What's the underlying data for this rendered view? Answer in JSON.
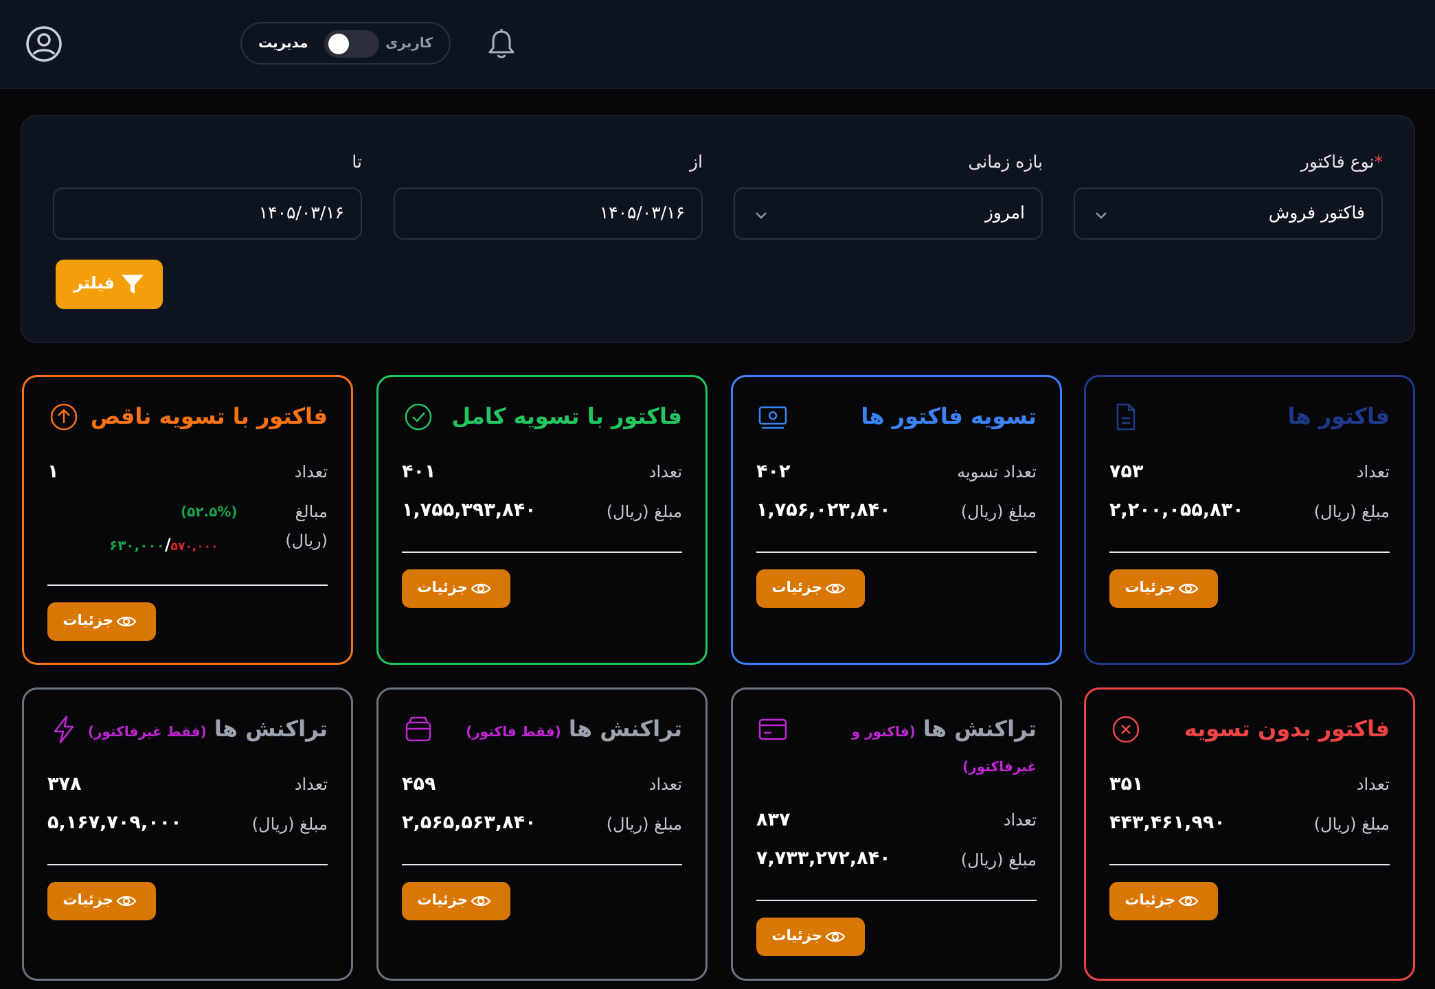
{
  "header": {
    "mode_admin": "مدیریت",
    "mode_user": "کاربری"
  },
  "filter": {
    "invoice_type_label": "نوع فاکتور",
    "invoice_type_required": "*",
    "invoice_type_value": "فاکتور فروش",
    "range_label": "بازه زمانی",
    "range_value": "امروز",
    "from_label": "از",
    "from_value": "۱۴۰۵/۰۳/۱۶",
    "to_label": "تا",
    "to_value": "۱۴۰۵/۰۳/۱۶",
    "button_label": "فیلتر"
  },
  "cards": {
    "invoices": {
      "title": "فاکتور ها",
      "count_label": "تعداد",
      "count": "۷۵۳",
      "amount_label": "مبلغ (ریال)",
      "amount": "۲,۲۰۰,۰۵۵,۸۳۰",
      "details": "جزئیات"
    },
    "settlements": {
      "title": "تسویه فاکتور ها",
      "count_label": "تعداد تسویه",
      "count": "۴۰۲",
      "amount_label": "مبلغ (ریال)",
      "amount": "۱,۷۵۶,۰۲۳,۸۴۰",
      "details": "جزئیات"
    },
    "full_settled": {
      "title": "فاکتور با تسویه کامل",
      "count_label": "تعداد",
      "count": "۴۰۱",
      "amount_label": "مبلغ (ریال)",
      "amount": "۱,۷۵۵,۳۹۳,۸۴۰",
      "details": "جزئیات"
    },
    "partial_settled": {
      "title": "فاکتور با تسویه ناقص",
      "count_label": "تعداد",
      "count": "۱",
      "amount_label_1": "مبالغ",
      "amount_label_2": "(ریال)",
      "percent": "(۵۲.۵%)",
      "paid": "۶۳۰,۰۰۰",
      "separator": "/",
      "total": "۵۷۰,۰۰۰",
      "details": "جزئیات"
    },
    "unsettled": {
      "title": "فاکتور بدون تسویه",
      "count_label": "تعداد",
      "count": "۳۵۱",
      "amount_label": "مبلغ (ریال)",
      "amount": "۴۴۳,۴۶۱,۹۹۰",
      "details": "جزئیات"
    },
    "tx_all": {
      "title": "تراکنش ها",
      "subtitle_1": "(فاکتور و",
      "subtitle_2": "غیرفاکتور)",
      "count_label": "تعداد",
      "count": "۸۳۷",
      "amount_label": "مبلغ (ریال)",
      "amount": "۷,۷۳۳,۲۷۲,۸۴۰",
      "details": "جزئیات"
    },
    "tx_invoice": {
      "title": "تراکنش ها",
      "subtitle": "(فقط فاکتور)",
      "count_label": "تعداد",
      "count": "۴۵۹",
      "amount_label": "مبلغ (ریال)",
      "amount": "۲,۵۶۵,۵۶۳,۸۴۰",
      "details": "جزئیات"
    },
    "tx_non_invoice": {
      "title": "تراکنش ها",
      "subtitle": "(فقط غیرفاکتور)",
      "count_label": "تعداد",
      "count": "۳۷۸",
      "amount_label": "مبلغ (ریال)",
      "amount": "۵,۱۶۷,۷۰۹,۰۰۰",
      "details": "جزئیات"
    }
  },
  "colors": {
    "orange": "#f97316",
    "green": "#22c55e",
    "blue": "#3b82f6",
    "navy": "#1e3a8a",
    "red": "#ef4444",
    "gray": "#6b7280",
    "accent": "#d97706",
    "purple": "#c026d3"
  },
  "icons": {
    "avatar": "user-circle-icon",
    "bell": "bell-icon",
    "filter": "funnel-icon",
    "invoices": "document-icon",
    "settlements": "banknote-icon",
    "full_settled": "check-circle-icon",
    "partial_settled": "arrow-up-circle-icon",
    "unsettled": "x-circle-icon",
    "tx_all": "credit-card-icon",
    "tx_invoice": "wallet-icon",
    "tx_non_invoice": "lightning-icon"
  }
}
